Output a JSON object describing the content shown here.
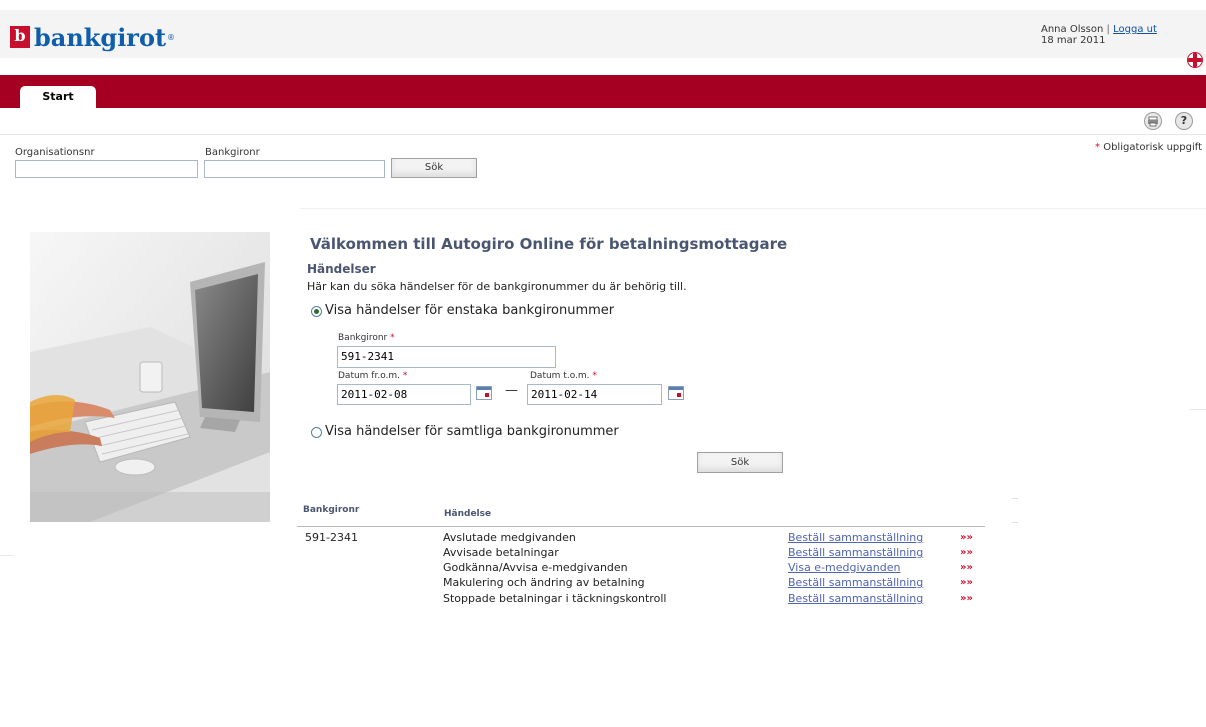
{
  "brand": {
    "logo_mark": "b",
    "logo_text": "bankgirot",
    "logo_reg": "®"
  },
  "user": {
    "name": "Anna Olsson",
    "separator": "|",
    "logout": "Logga ut",
    "date": "18 mar 2011"
  },
  "nav": {
    "tabs": [
      {
        "label": "Start",
        "active": true
      }
    ]
  },
  "toolbar": {
    "print_icon": "print-icon",
    "help_icon": "help-icon",
    "help_glyph": "?"
  },
  "top_search": {
    "org_label": "Organisationsnr",
    "org_value": "",
    "bankgiro_label": "Bankgironr",
    "bankgiro_value": "",
    "button": "Sök"
  },
  "required_note": {
    "star": "*",
    "text": " Obligatorisk uppgift"
  },
  "main": {
    "title": "Välkommen till Autogiro Online för betalningsmottagare",
    "section_heading": "Händelser",
    "intro": "Här kan du söka händelser för de bankgironummer du är behörig till.",
    "radio_single": {
      "label": "Visa händelser för enstaka bankgironummer",
      "checked": true
    },
    "radio_all": {
      "label": "Visa händelser för samtliga bankgironummer",
      "checked": false
    },
    "form": {
      "bankgiro_label": "Bankgironr",
      "bankgiro_value": "591-2341",
      "from_label": "Datum fr.o.m.",
      "from_value": "2011-02-08",
      "to_label": "Datum t.o.m.",
      "to_value": "2011-02-14",
      "required_star": "*",
      "date_separator": "—"
    },
    "search_button": "Sök"
  },
  "events_table": {
    "headers": {
      "bankgiro": "Bankgironr",
      "event": "Händelse"
    },
    "bankgiro": "591-2341",
    "rows": [
      {
        "event": "Avslutade medgivanden",
        "action": "Beställ sammanställning",
        "arrow": "»»"
      },
      {
        "event": "Avvisade betalningar",
        "action": "Beställ sammanställning",
        "arrow": "»»"
      },
      {
        "event": "Godkänna/Avvisa e-medgivanden",
        "action": "Visa e-medgivanden",
        "arrow": "»»"
      },
      {
        "event": "Makulering och ändring av betalning",
        "action": "Beställ sammanställning",
        "arrow": "»»"
      },
      {
        "event": "Stoppade betalningar i täckningskontroll",
        "action": "Beställ sammanställning",
        "arrow": "»»"
      }
    ]
  },
  "colors": {
    "brand_blue": "#0f5eab",
    "nav_red": "#a50021",
    "heading": "#4a5670",
    "link": "#5064b4",
    "required": "#c8102e"
  }
}
